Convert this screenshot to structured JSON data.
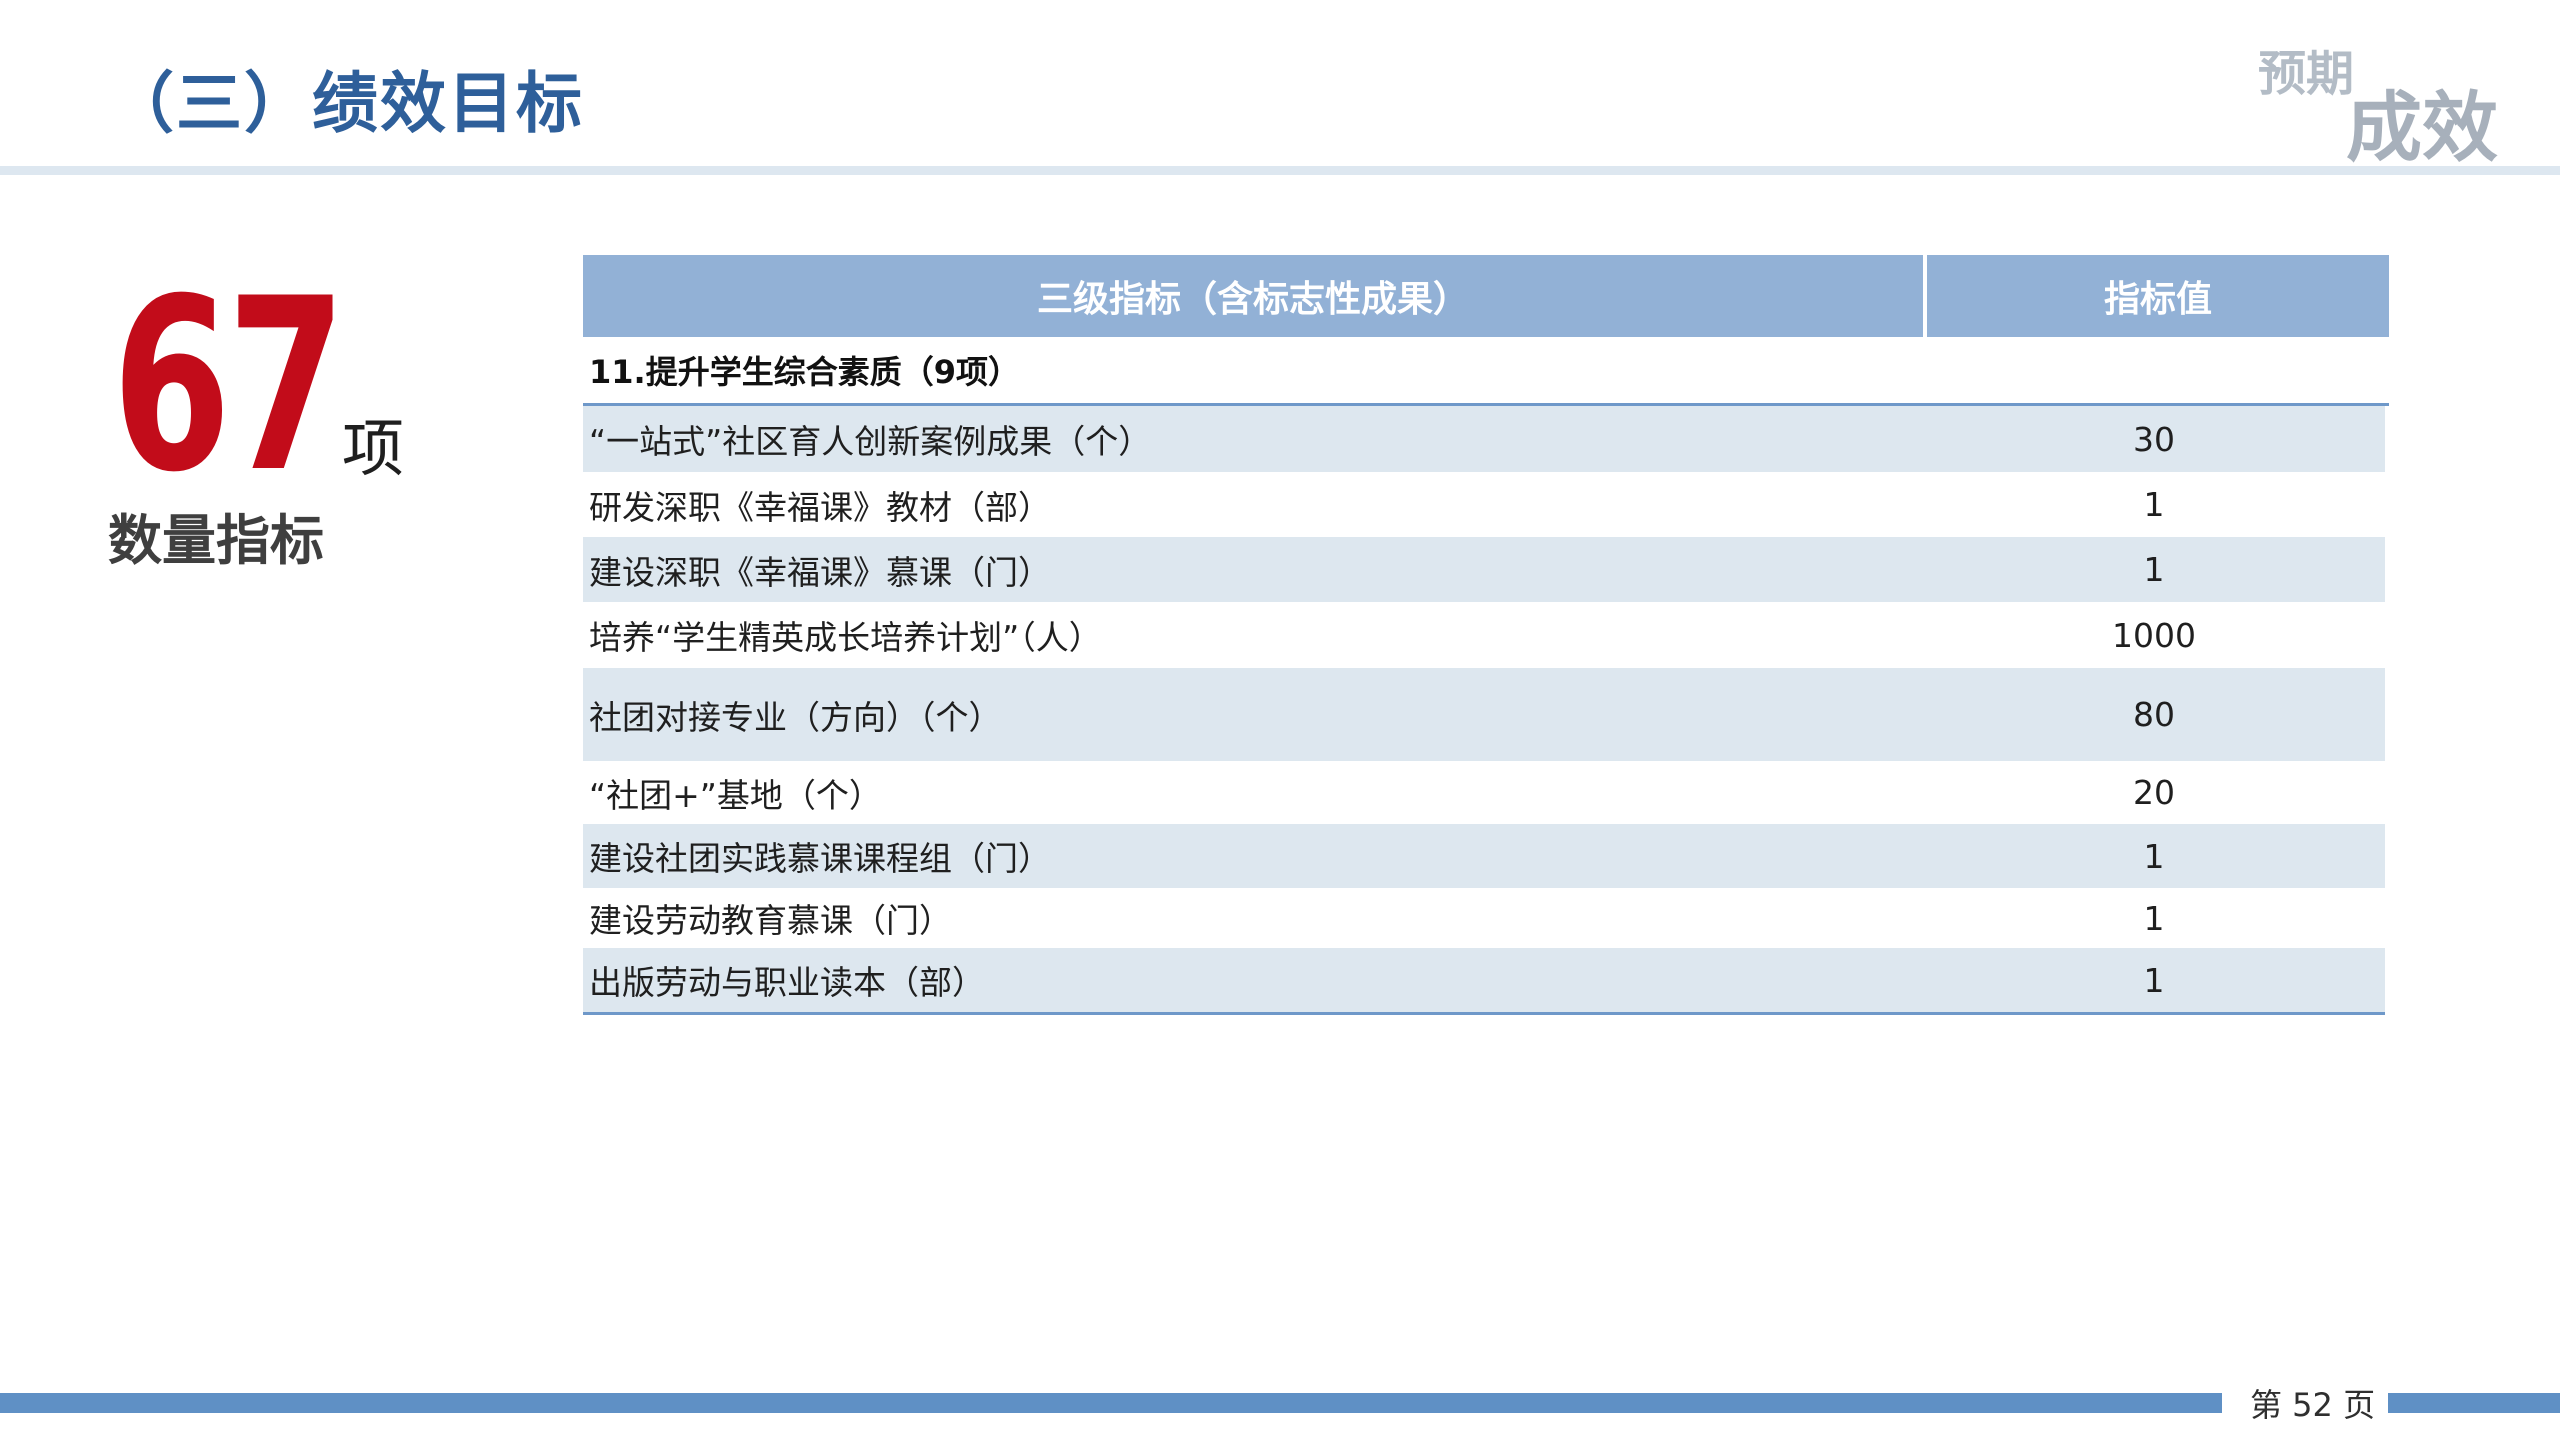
{
  "header": {
    "title": "（三）绩效目标",
    "corner_small": "预期",
    "corner_large": "成效"
  },
  "summary": {
    "count": "67",
    "unit": "项",
    "label": "数量指标"
  },
  "table": {
    "headers": [
      "三级指标（含标志性成果）",
      "指标值"
    ],
    "section": "11.提升学生综合素质（9项）",
    "rows": [
      {
        "indicator": "“一站式”社区育人创新案例成果（个）",
        "value": "30"
      },
      {
        "indicator": "研发深职《幸福课》教材（部）",
        "value": "1"
      },
      {
        "indicator": "建设深职《幸福课》慕课（门）",
        "value": "1"
      },
      {
        "indicator": "培养“学生精英成长培养计划”（人）",
        "value": "1000"
      },
      {
        "indicator": "社团对接专业（方向）（个）",
        "value": "80"
      },
      {
        "indicator": "“社团+”基地（个）",
        "value": "20"
      },
      {
        "indicator": "建设社团实践慕课课程组（门）",
        "value": "1"
      },
      {
        "indicator": "建设劳动教育慕课（门）",
        "value": "1"
      },
      {
        "indicator": "出版劳动与职业读本（部）",
        "value": "1"
      }
    ]
  },
  "footer": {
    "page": "第 52 页"
  },
  "colors": {
    "title_blue": "#2e5f9a",
    "header_fill": "#92b1d6",
    "row_alt": "#dde7ef",
    "number_red": "#c20c1a",
    "footer_blue": "#5f90c5"
  }
}
